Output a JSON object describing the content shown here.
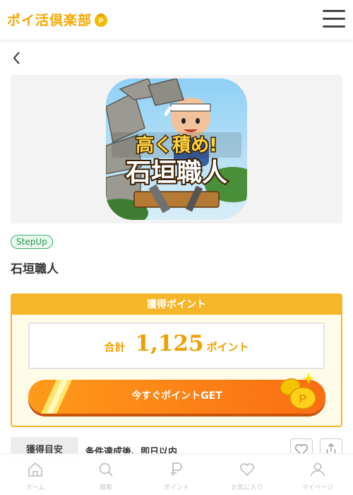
{
  "header": {
    "logo_text": "ポイ活倶楽部",
    "brand_color": "#f5a800"
  },
  "offer": {
    "tag": "StepUp",
    "title": "石垣職人",
    "app_icon_text_line1": "高く積め!",
    "app_icon_text_line2": "石垣職人"
  },
  "points": {
    "header": "獲得ポイント",
    "total_label": "合計",
    "total_value": "1,125",
    "total_unit": "ポイント",
    "cta_label": "今すぐポイントGET",
    "accent_color": "#f7b52a",
    "cta_color": "#fb6d13"
  },
  "meta": {
    "label": "獲得目安",
    "value": "条件達成後、即日以内"
  },
  "nav": {
    "items": [
      {
        "label": "ホーム",
        "icon": "home-icon"
      },
      {
        "label": "検索",
        "icon": "search-icon"
      },
      {
        "label": "ポイント",
        "icon": "point-icon"
      },
      {
        "label": "お気に入り",
        "icon": "heart-icon"
      },
      {
        "label": "マイページ",
        "icon": "user-icon"
      }
    ]
  }
}
